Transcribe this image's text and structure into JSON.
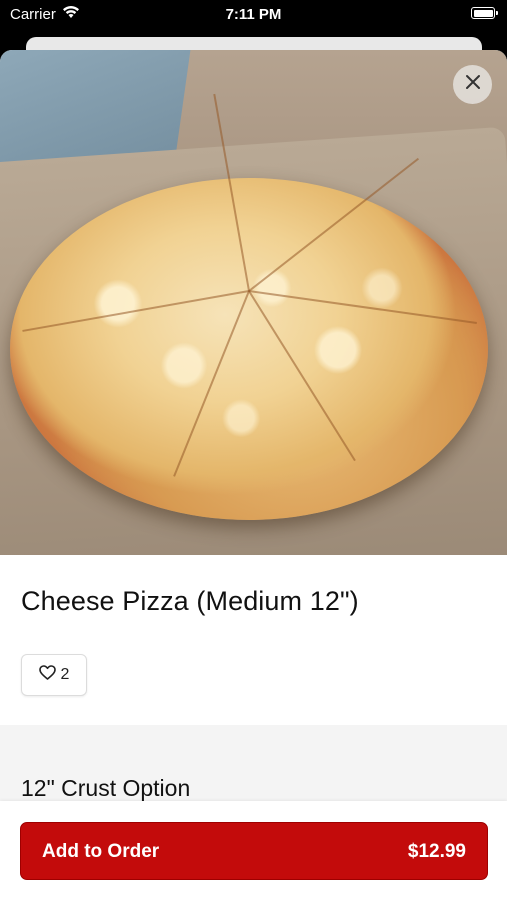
{
  "status_bar": {
    "carrier": "Carrier",
    "time": "7:11 PM"
  },
  "item": {
    "title": "Cheese Pizza (Medium 12\")",
    "likes": "2"
  },
  "options": {
    "section_title": "12\" Crust Option"
  },
  "cta": {
    "label": "Add to Order",
    "price": "$12.99",
    "color": "#c30b0b"
  },
  "icons": {
    "close": "close-icon",
    "heart": "heart-icon",
    "wifi": "wifi-icon",
    "battery": "battery-icon"
  }
}
